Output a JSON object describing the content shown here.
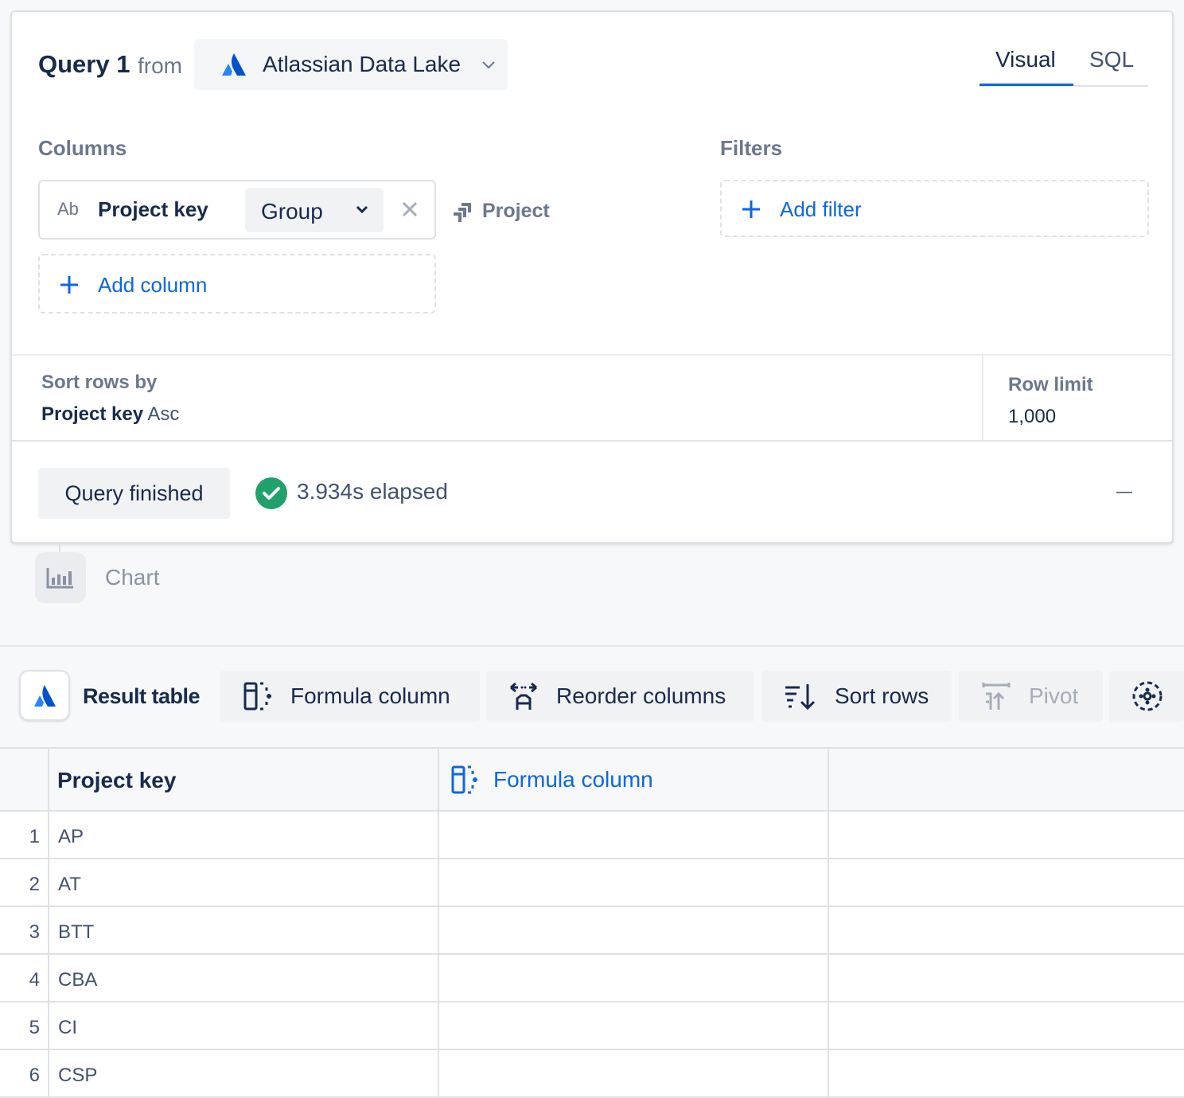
{
  "query": {
    "title": "Query 1",
    "from_label": "from",
    "source": "Atlassian Data Lake",
    "tabs": [
      "Visual",
      "SQL"
    ],
    "active_tab": "Visual",
    "columns_label": "Columns",
    "filters_label": "Filters",
    "column": {
      "type_badge": "Ab",
      "name": "Project key",
      "aggregation": "Group",
      "related": "Project"
    },
    "add_column_label": "Add column",
    "add_filter_label": "Add filter",
    "sort_label": "Sort rows by",
    "sort_field": "Project key",
    "sort_dir": "Asc",
    "row_limit_label": "Row limit",
    "row_limit": "1,000",
    "status": "Query finished",
    "elapsed": "3.934s elapsed"
  },
  "chart_node": {
    "label": "Chart"
  },
  "toolbar": {
    "result_table_label": "Result table",
    "buttons": [
      {
        "label": "Formula column",
        "icon": "formula-column-icon",
        "disabled": false
      },
      {
        "label": "Reorder columns",
        "icon": "reorder-columns-icon",
        "disabled": false
      },
      {
        "label": "Sort rows",
        "icon": "sort-rows-icon",
        "disabled": false
      },
      {
        "label": "Pivot",
        "icon": "pivot-icon",
        "disabled": true
      }
    ]
  },
  "table": {
    "headers": [
      "Project key",
      "Formula column"
    ],
    "rows": [
      {
        "n": "1",
        "key": "AP"
      },
      {
        "n": "2",
        "key": "AT"
      },
      {
        "n": "3",
        "key": "BTT"
      },
      {
        "n": "4",
        "key": "CBA"
      },
      {
        "n": "5",
        "key": "CI"
      },
      {
        "n": "6",
        "key": "CSP"
      }
    ]
  },
  "colors": {
    "accent": "#0c66e4",
    "success": "#22a06b",
    "text": "#172b4d",
    "subtle": "#6b778c"
  }
}
